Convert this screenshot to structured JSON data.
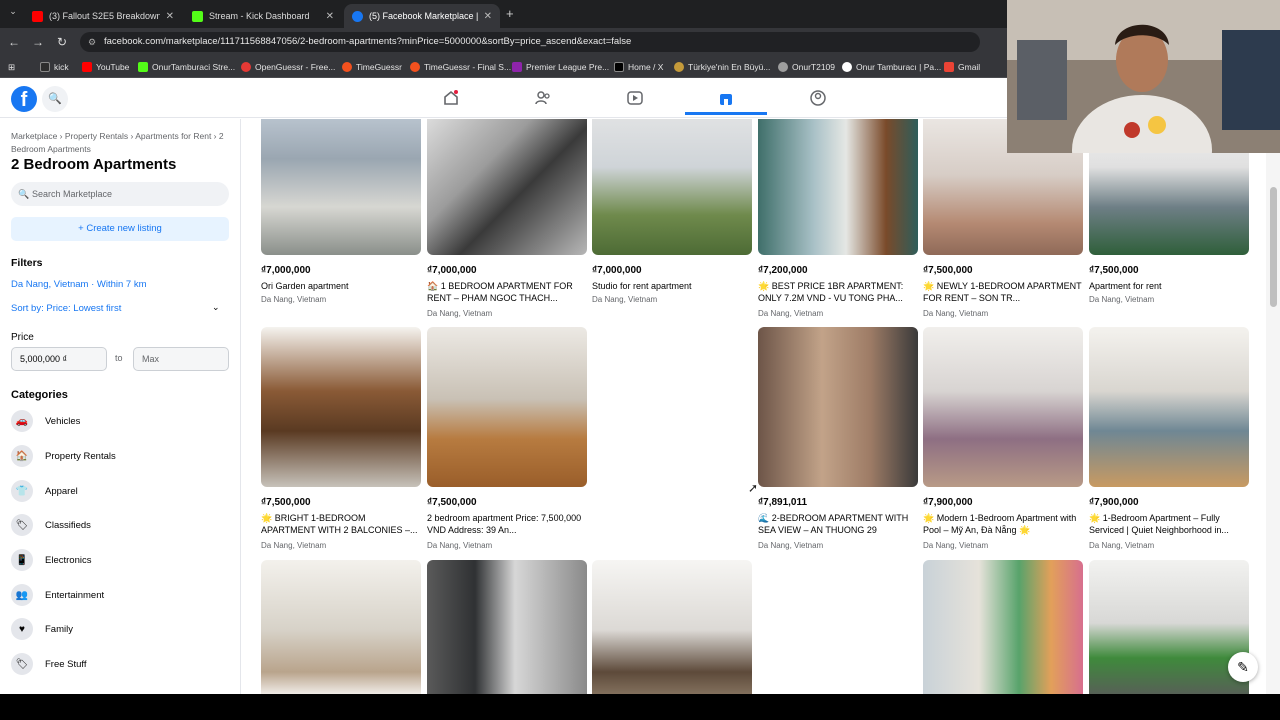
{
  "browser": {
    "tabs": [
      {
        "title": "(3) Fallout S2E5 Breakdown of T",
        "active": false
      },
      {
        "title": "Stream - Kick Dashboard",
        "active": false
      },
      {
        "title": "(5) Facebook Marketplace | Fac",
        "active": true
      }
    ],
    "url": "facebook.com/marketplace/111711568847056/2-bedroom-apartments?minPrice=5000000&sortBy=price_ascend&exact=false",
    "bookmarks": [
      "kick",
      "YouTube",
      "OnurTamburaci Stre...",
      "OpenGuessr - Free...",
      "TimeGuessr",
      "TimeGuessr - Final S...",
      "Premier League Pre...",
      "Home / X",
      "Türkiye'nin En Büyü...",
      "OnurT2109",
      "Onur Tamburacı | Pa...",
      "Gmail"
    ]
  },
  "header": {
    "logo": "f",
    "nav": [
      {
        "icon": "home-icon"
      },
      {
        "icon": "friends-icon"
      },
      {
        "icon": "video-icon"
      },
      {
        "icon": "marketplace-icon"
      },
      {
        "icon": "profile-icon"
      }
    ]
  },
  "sidebar": {
    "breadcrumb": "Marketplace › Property Rentals › Apartments for Rent › 2 Bedroom Apartments",
    "title": "2 Bedroom Apartments",
    "search_placeholder": "Search Marketplace",
    "create_label": "+ Create new listing",
    "filters_heading": "Filters",
    "location": "Da Nang, Vietnam · Within 7 km",
    "sort": "Sort by: Price: Lowest first",
    "price_heading": "Price",
    "price_min": "5,000,000 ₫",
    "price_to": "to",
    "price_max_placeholder": "Max",
    "categories_heading": "Categories",
    "categories": [
      "Vehicles",
      "Property Rentals",
      "Apparel",
      "Classifieds",
      "Electronics",
      "Entertainment",
      "Family",
      "Free Stuff"
    ]
  },
  "listings": [
    {
      "price": "₫7,000,000",
      "title": "Ori Garden apartment",
      "location": "Da Nang, Vietnam"
    },
    {
      "price": "₫7,000,000",
      "title": "🏠 1 BEDROOM APARTMENT FOR RENT – PHAM NGOC THACH...",
      "location": "Da Nang, Vietnam"
    },
    {
      "price": "₫7,000,000",
      "title": "Studio for rent apartment",
      "location": "Da Nang, Vietnam"
    },
    {
      "price": "₫7,200,000",
      "title": "🌟 BEST PRICE 1BR APARTMENT: ONLY 7.2M VND - VU TONG PHA...",
      "location": "Da Nang, Vietnam"
    },
    {
      "price": "₫7,500,000",
      "title": "🌟 NEWLY 1-BEDROOM APARTMENT FOR RENT – SON TR...",
      "location": "Da Nang, Vietnam"
    },
    {
      "price": "₫7,500,000",
      "title": "Apartment for rent",
      "location": "Da Nang, Vietnam"
    },
    {
      "price": "₫7,500,000",
      "title": "🌟 BRIGHT 1-BEDROOM APARTMENT WITH 2 BALCONIES –...",
      "location": "Da Nang, Vietnam"
    },
    {
      "price": "₫7,500,000",
      "title": "2 bedroom apartment Price: 7,500,000 VND Address: 39 An...",
      "location": "Da Nang, Vietnam"
    },
    {
      "price": "₫7,891,011",
      "title": "🌊 2-BEDROOM APARTMENT WITH SEA VIEW – AN THUONG 29",
      "location": "Da Nang, Vietnam"
    },
    {
      "price": "₫7,900,000",
      "title": "🌟 Modern 1-Bedroom Apartment with Pool – Mỹ An, Đà Nẵng 🌟",
      "location": "Da Nang, Vietnam"
    },
    {
      "price": "₫7,900,000",
      "title": "🌟 1-Bedroom Apartment – Fully Serviced | Quiet Neighborhood in...",
      "location": "Da Nang, Vietnam"
    }
  ]
}
